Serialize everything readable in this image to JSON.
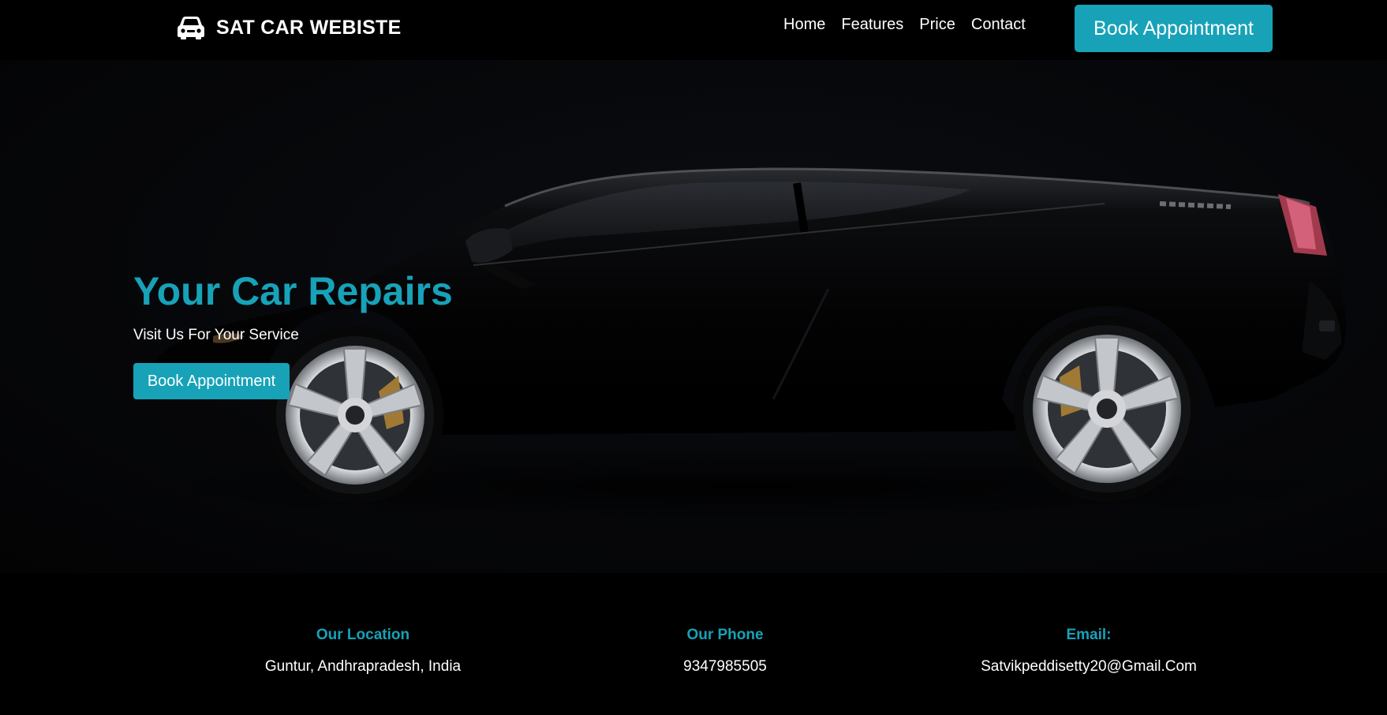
{
  "colors": {
    "accent": "#17a2b8",
    "background": "#000000",
    "text": "#ffffff"
  },
  "navbar": {
    "brand_icon": "car-icon",
    "brand_text": "SAT CAR WEBISTE",
    "links": [
      {
        "label": "Home"
      },
      {
        "label": "Features"
      },
      {
        "label": "Price"
      },
      {
        "label": "Contact"
      }
    ],
    "cta_label": "Book Appointment"
  },
  "hero": {
    "title": "Your Car Repairs",
    "subtitle": "Visit Us For Your Service",
    "cta_label": "Book Appointment"
  },
  "contact": {
    "columns": [
      {
        "heading": "Our Location",
        "value": "Guntur, Andhrapradesh, India"
      },
      {
        "heading": "Our Phone",
        "value": "9347985505"
      },
      {
        "heading": "Email:",
        "value": "Satvikpeddisetty20@Gmail.Com"
      }
    ]
  }
}
